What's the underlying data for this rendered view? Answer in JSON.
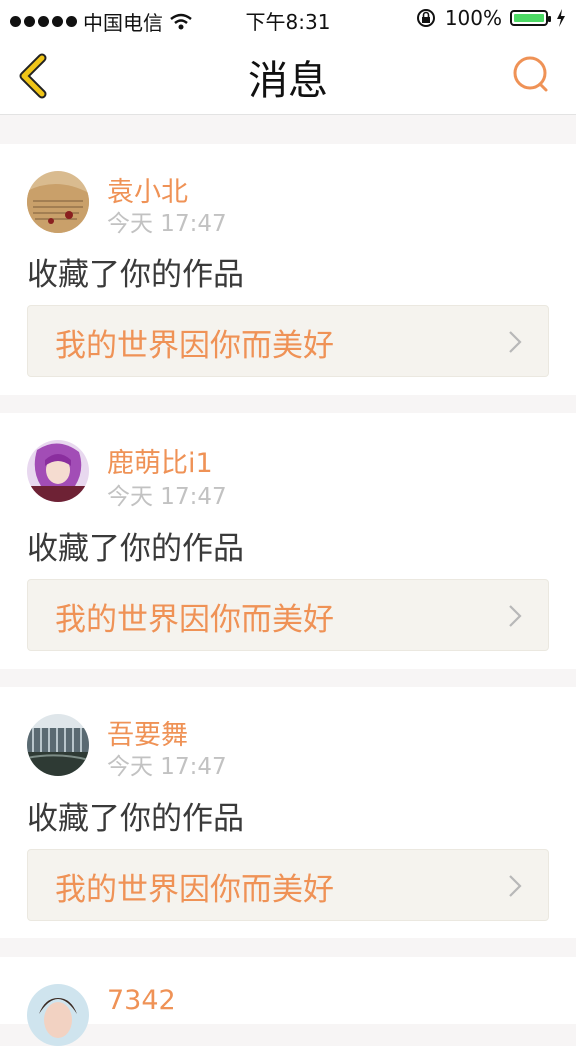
{
  "status_bar": {
    "carrier": "中国电信",
    "time": "下午8:31",
    "battery": "100%"
  },
  "nav": {
    "title": "消息"
  },
  "messages": [
    {
      "user": "袁小北",
      "time": "今天 17:47",
      "action": "收藏了你的作品",
      "work_title": "我的世界因你而美好"
    },
    {
      "user": "鹿萌比i1",
      "time": "今天 17:47",
      "action": "收藏了你的作品",
      "work_title": "我的世界因你而美好"
    },
    {
      "user": "吾要舞",
      "time": "今天 17:47",
      "action": "收藏了你的作品",
      "work_title": "我的世界因你而美好"
    },
    {
      "user": "7342"
    }
  ],
  "colors": {
    "accent": "#ef9256",
    "timestamp": "#c2c2c2",
    "back_icon": "#f0c518",
    "work_bg": "#f5f3ee",
    "page_bg": "#f7f5f5"
  }
}
